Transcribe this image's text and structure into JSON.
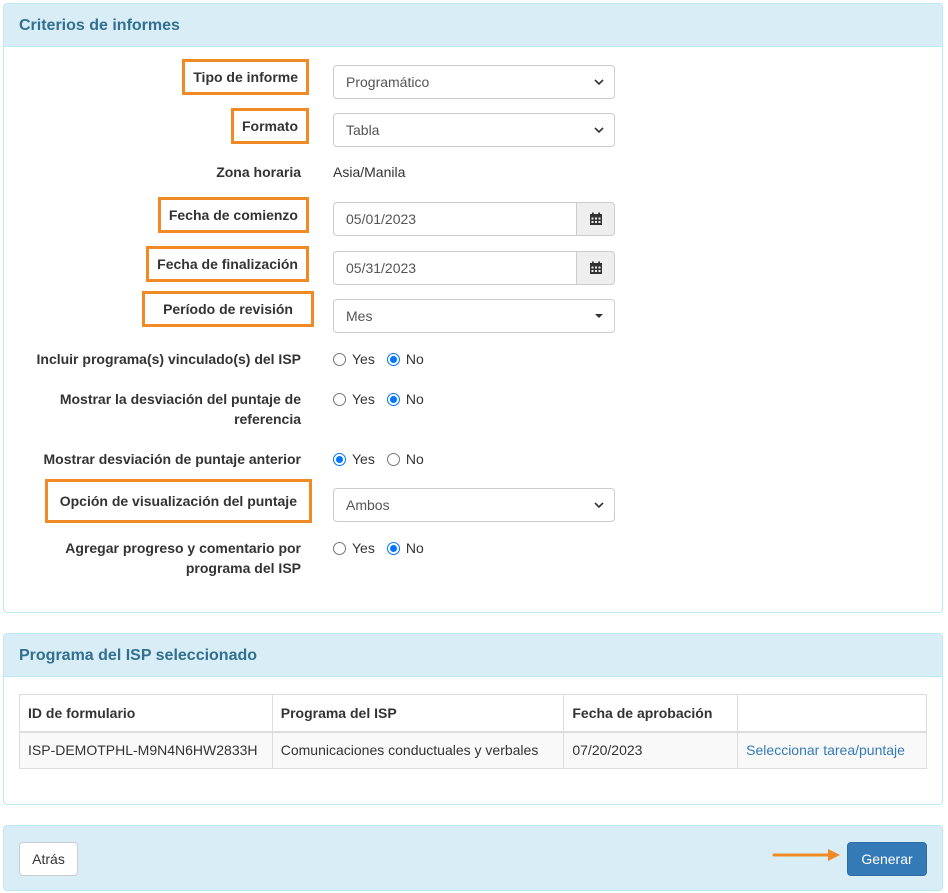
{
  "criteria": {
    "title": "Criterios de informes",
    "report_type": {
      "label": "Tipo de informe",
      "value": "Programático"
    },
    "format": {
      "label": "Formato",
      "value": "Tabla"
    },
    "timezone": {
      "label": "Zona horaria",
      "value": "Asia/Manila"
    },
    "start_date": {
      "label": "Fecha de comienzo",
      "value": "05/01/2023"
    },
    "end_date": {
      "label": "Fecha de finalización",
      "value": "05/31/2023"
    },
    "review_period": {
      "label": "Período de revisión",
      "value": "Mes"
    },
    "include_linked": {
      "label": "Incluir programa(s) vinculado(s) del ISP",
      "yes": "Yes",
      "no": "No",
      "selected": "No"
    },
    "show_baseline": {
      "label_line1": "Mostrar la desviación del puntaje de",
      "label_line2": "referencia",
      "yes": "Yes",
      "no": "No",
      "selected": "No"
    },
    "show_previous": {
      "label": "Mostrar desviación de puntaje anterior",
      "yes": "Yes",
      "no": "No",
      "selected": "Yes"
    },
    "score_display": {
      "label": "Opción de visualización del puntaje",
      "value": "Ambos"
    },
    "add_progress": {
      "label_line1": "Agregar progreso y comentario por",
      "label_line2": "programa del ISP",
      "yes": "Yes",
      "no": "No",
      "selected": "No"
    }
  },
  "selected_program": {
    "title": "Programa del ISP seleccionado",
    "columns": [
      "ID de formulario",
      "Programa del ISP",
      "Fecha de aprobación",
      ""
    ],
    "rows": [
      {
        "form_id": "ISP-DEMOTPHL-M9N4N6HW2833H",
        "program": "Comunicaciones conductuales y verbales",
        "approval_date": "07/20/2023",
        "action": "Seleccionar tarea/puntaje"
      }
    ]
  },
  "footer": {
    "back_label": "Atrás",
    "generate_label": "Generar"
  },
  "colors": {
    "highlight": "#f08a24",
    "primary": "#337ab7",
    "panel_heading": "#d9edf7"
  }
}
